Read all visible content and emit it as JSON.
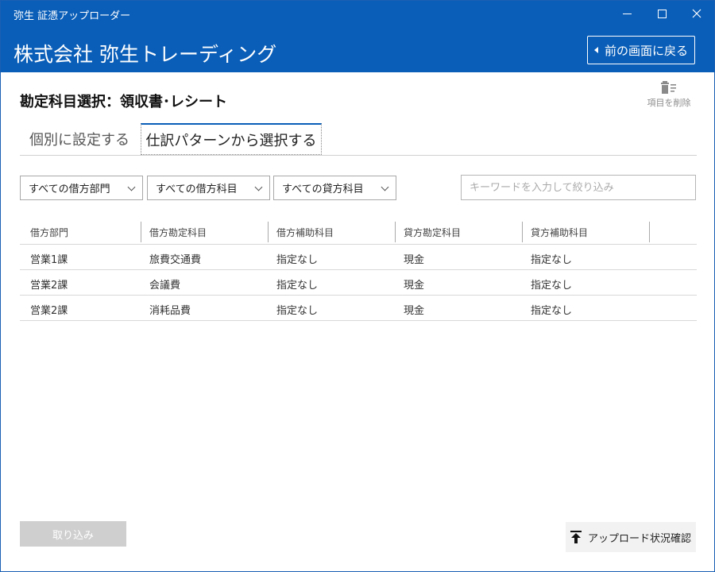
{
  "window": {
    "title": "弥生 証憑アップローダー",
    "company": "株式会社 弥生トレーディング",
    "back_label": "前の画面に戻る"
  },
  "page": {
    "title": "勘定科目選択：領収書･レシート",
    "delete_label": "項目を削除"
  },
  "tabs": [
    {
      "label": "個別に設定する",
      "active": false
    },
    {
      "label": "仕訳パターンから選択する",
      "active": true
    }
  ],
  "filters": {
    "dept": "すべての借方部門",
    "debit_account": "すべての借方科目",
    "credit_account": "すべての貸方科目",
    "search_placeholder": "キーワードを入力して絞り込み"
  },
  "table": {
    "headers": [
      "借方部門",
      "借方勘定科目",
      "借方補助科目",
      "貸方勘定科目",
      "貸方補助科目"
    ],
    "rows": [
      [
        "営業1課",
        "旅費交通費",
        "指定なし",
        "現金",
        "指定なし"
      ],
      [
        "営業2課",
        "会議費",
        "指定なし",
        "現金",
        "指定なし"
      ],
      [
        "営業2課",
        "消耗品費",
        "指定なし",
        "現金",
        "指定なし"
      ]
    ]
  },
  "footer": {
    "import_label": "取り込み",
    "upload_status_label": "アップロード状況確認"
  },
  "colors": {
    "accent": "#0a5eb8",
    "disabled": "#cfcfcf"
  }
}
